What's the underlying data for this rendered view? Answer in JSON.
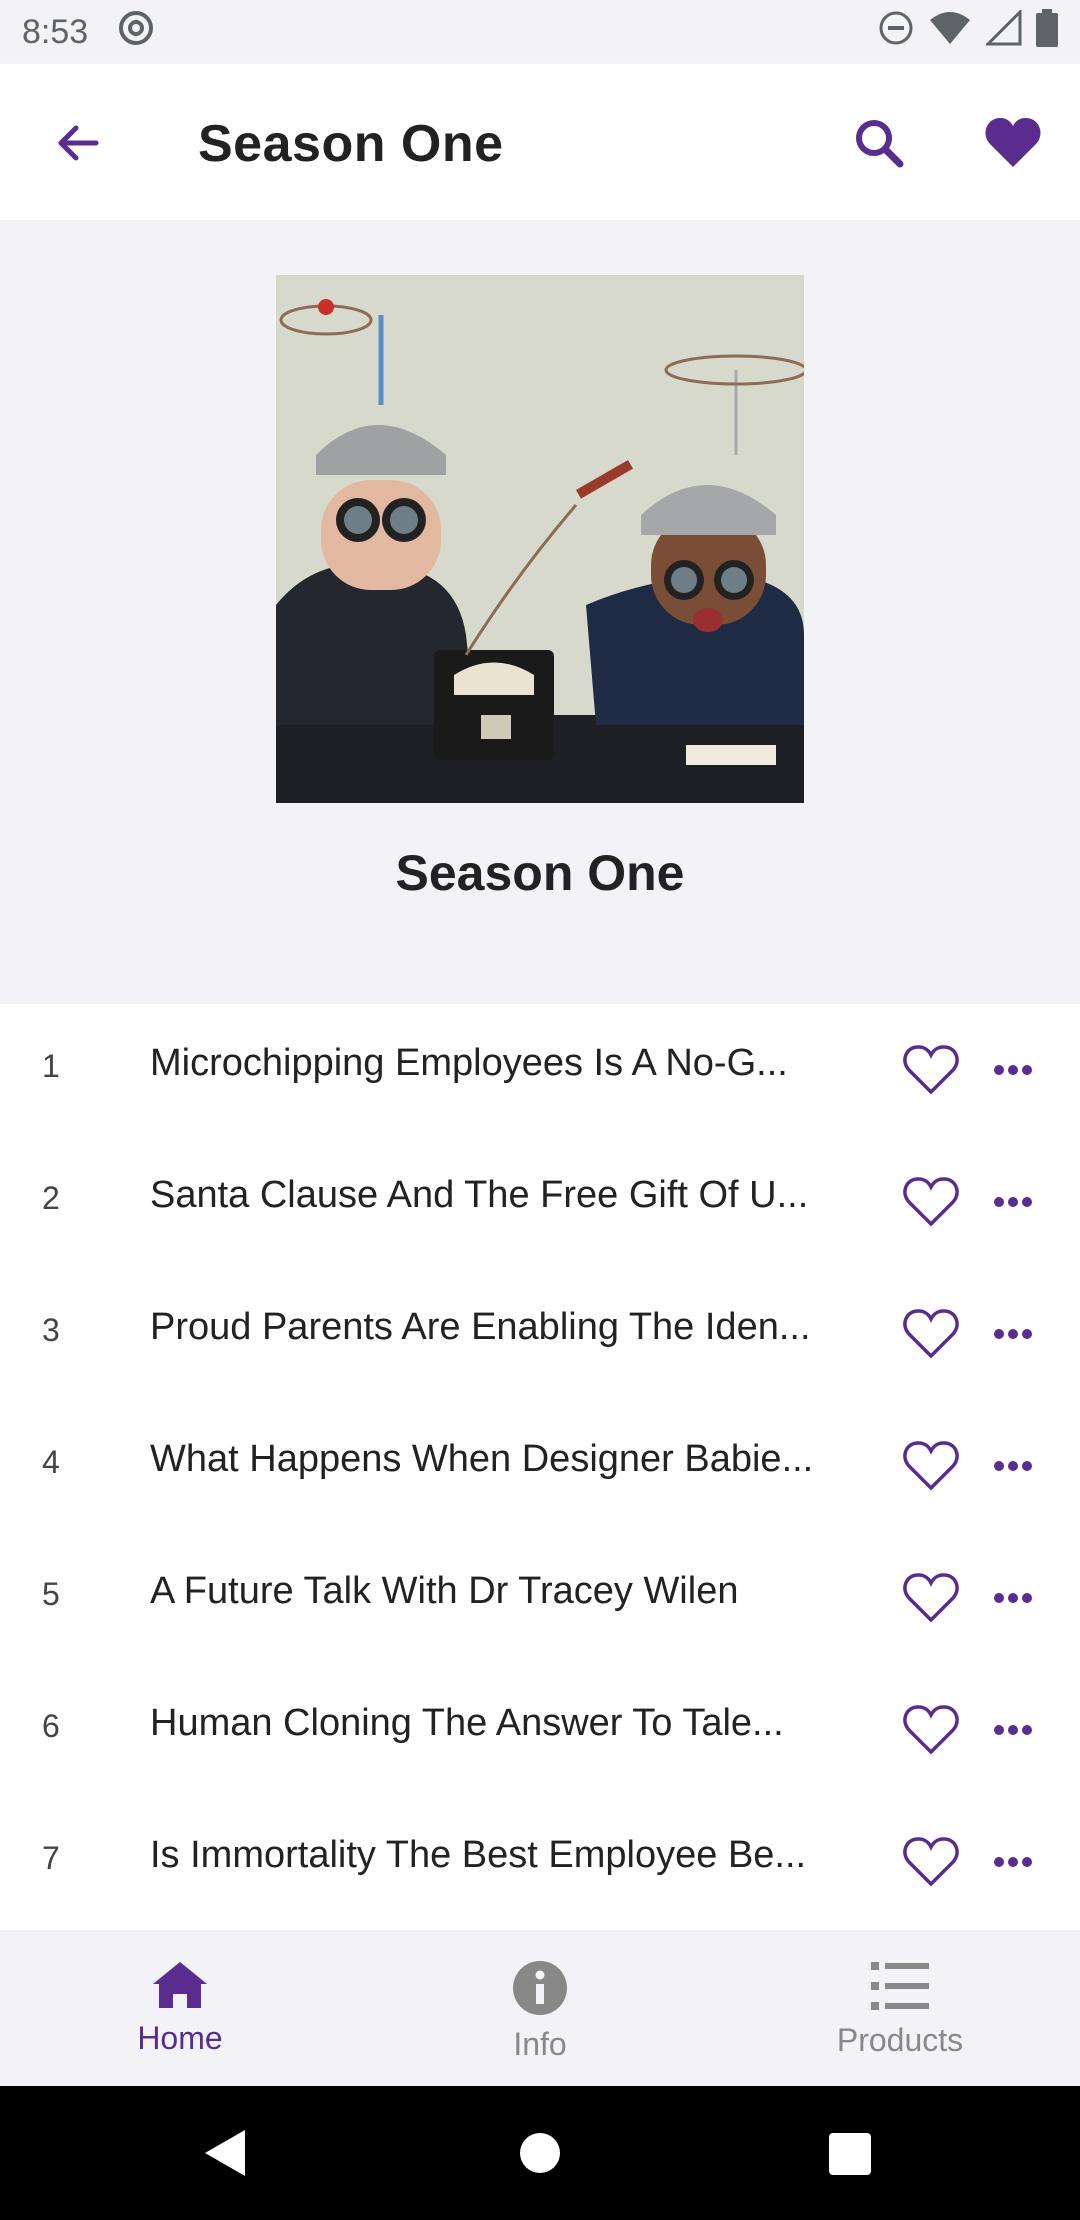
{
  "status_bar": {
    "time": "8:53"
  },
  "app_bar": {
    "title": "Season One"
  },
  "hero": {
    "title": "Season One"
  },
  "tracks": [
    {
      "num": "1",
      "title": "Microchipping Employees Is A No-G..."
    },
    {
      "num": "2",
      "title": "Santa Clause And The Free Gift Of U..."
    },
    {
      "num": "3",
      "title": "Proud Parents Are Enabling The Iden..."
    },
    {
      "num": "4",
      "title": "What Happens When Designer Babie..."
    },
    {
      "num": "5",
      "title": "A Future Talk With Dr Tracey Wilen"
    },
    {
      "num": "6",
      "title": "Human Cloning The Answer To Tale..."
    },
    {
      "num": "7",
      "title": "Is Immortality The Best Employee Be..."
    }
  ],
  "bottom_nav": {
    "items": [
      {
        "label": "Home",
        "icon": "home-icon",
        "active": true
      },
      {
        "label": "Info",
        "icon": "info-icon",
        "active": false
      },
      {
        "label": "Products",
        "icon": "list-icon",
        "active": false
      }
    ]
  },
  "colors": {
    "accent": "#5b2c8f",
    "inactive": "#888888"
  }
}
